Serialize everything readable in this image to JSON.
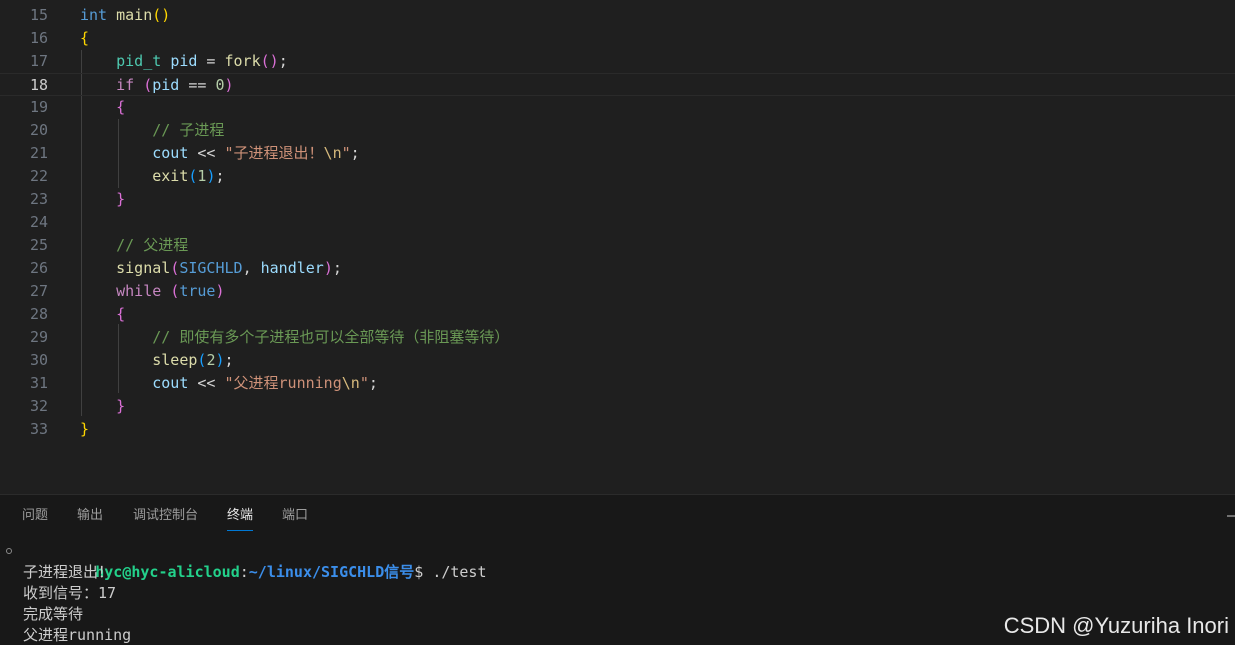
{
  "editor": {
    "active_line": 18,
    "lines": [
      {
        "num": "15",
        "tokens": [
          {
            "t": "int",
            "c": "keyword"
          },
          {
            "t": " "
          },
          {
            "t": "main",
            "c": "func"
          },
          {
            "t": "()",
            "c": "brace1"
          }
        ]
      },
      {
        "num": "16",
        "tokens": [
          {
            "t": "{",
            "c": "brace1"
          }
        ]
      },
      {
        "num": "17",
        "tokens": [
          {
            "t": "    "
          },
          {
            "t": "pid_t",
            "c": "type"
          },
          {
            "t": " "
          },
          {
            "t": "pid",
            "c": "var"
          },
          {
            "t": " = "
          },
          {
            "t": "fork",
            "c": "func"
          },
          {
            "t": "()",
            "c": "brace2"
          },
          {
            "t": ";"
          }
        ]
      },
      {
        "num": "18",
        "tokens": [
          {
            "t": "    "
          },
          {
            "t": "if",
            "c": "control"
          },
          {
            "t": " "
          },
          {
            "t": "(",
            "c": "brace2"
          },
          {
            "t": "pid",
            "c": "var"
          },
          {
            "t": " == "
          },
          {
            "t": "0",
            "c": "num"
          },
          {
            "t": ")",
            "c": "brace2"
          }
        ]
      },
      {
        "num": "19",
        "tokens": [
          {
            "t": "    "
          },
          {
            "t": "{",
            "c": "brace2"
          }
        ]
      },
      {
        "num": "20",
        "tokens": [
          {
            "t": "        "
          },
          {
            "t": "// 子进程",
            "c": "comment"
          }
        ]
      },
      {
        "num": "21",
        "tokens": [
          {
            "t": "        "
          },
          {
            "t": "cout",
            "c": "var"
          },
          {
            "t": " << "
          },
          {
            "t": "\"子进程退出！",
            "c": "str"
          },
          {
            "t": "\\n",
            "c": "escape"
          },
          {
            "t": "\"",
            "c": "str"
          },
          {
            "t": ";"
          }
        ]
      },
      {
        "num": "22",
        "tokens": [
          {
            "t": "        "
          },
          {
            "t": "exit",
            "c": "func"
          },
          {
            "t": "(",
            "c": "brace3"
          },
          {
            "t": "1",
            "c": "num"
          },
          {
            "t": ")",
            "c": "brace3"
          },
          {
            "t": ";"
          }
        ]
      },
      {
        "num": "23",
        "tokens": [
          {
            "t": "    "
          },
          {
            "t": "}",
            "c": "brace2"
          }
        ]
      },
      {
        "num": "24",
        "tokens": []
      },
      {
        "num": "25",
        "tokens": [
          {
            "t": "    "
          },
          {
            "t": "// 父进程",
            "c": "comment"
          }
        ]
      },
      {
        "num": "26",
        "tokens": [
          {
            "t": "    "
          },
          {
            "t": "signal",
            "c": "func"
          },
          {
            "t": "(",
            "c": "brace2"
          },
          {
            "t": "SIGCHLD",
            "c": "macro"
          },
          {
            "t": ", "
          },
          {
            "t": "handler",
            "c": "var"
          },
          {
            "t": ")",
            "c": "brace2"
          },
          {
            "t": ";"
          }
        ]
      },
      {
        "num": "27",
        "tokens": [
          {
            "t": "    "
          },
          {
            "t": "while",
            "c": "control"
          },
          {
            "t": " "
          },
          {
            "t": "(",
            "c": "brace2"
          },
          {
            "t": "true",
            "c": "keyword"
          },
          {
            "t": ")",
            "c": "brace2"
          }
        ]
      },
      {
        "num": "28",
        "tokens": [
          {
            "t": "    "
          },
          {
            "t": "{",
            "c": "brace2"
          }
        ]
      },
      {
        "num": "29",
        "tokens": [
          {
            "t": "        "
          },
          {
            "t": "// 即使有多个子进程也可以全部等待（非阻塞等待）",
            "c": "comment"
          }
        ]
      },
      {
        "num": "30",
        "tokens": [
          {
            "t": "        "
          },
          {
            "t": "sleep",
            "c": "func"
          },
          {
            "t": "(",
            "c": "brace3"
          },
          {
            "t": "2",
            "c": "num"
          },
          {
            "t": ")",
            "c": "brace3"
          },
          {
            "t": ";"
          }
        ]
      },
      {
        "num": "31",
        "tokens": [
          {
            "t": "        "
          },
          {
            "t": "cout",
            "c": "var"
          },
          {
            "t": " << "
          },
          {
            "t": "\"父进程running",
            "c": "str"
          },
          {
            "t": "\\n",
            "c": "escape"
          },
          {
            "t": "\"",
            "c": "str"
          },
          {
            "t": ";"
          }
        ]
      },
      {
        "num": "32",
        "tokens": [
          {
            "t": "    "
          },
          {
            "t": "}",
            "c": "brace2"
          }
        ]
      },
      {
        "num": "33",
        "tokens": [
          {
            "t": "}",
            "c": "brace1"
          }
        ]
      }
    ]
  },
  "panel": {
    "tabs": [
      {
        "label": "问题",
        "active": false
      },
      {
        "label": "输出",
        "active": false
      },
      {
        "label": "调试控制台",
        "active": false
      },
      {
        "label": "终端",
        "active": true
      },
      {
        "label": "端口",
        "active": false
      }
    ],
    "maximize_icon": "dash",
    "terminal": {
      "prompt_user": "hyc@hyc-alicloud",
      "prompt_sep": ":",
      "prompt_path": "~/linux/SIGCHLD信号",
      "prompt_end": "$ ",
      "command": "./test",
      "output": [
        "子进程退出！",
        "收到信号：17",
        "完成等待",
        "父进程running"
      ]
    }
  },
  "watermark": "CSDN @Yuzuriha  Inori"
}
